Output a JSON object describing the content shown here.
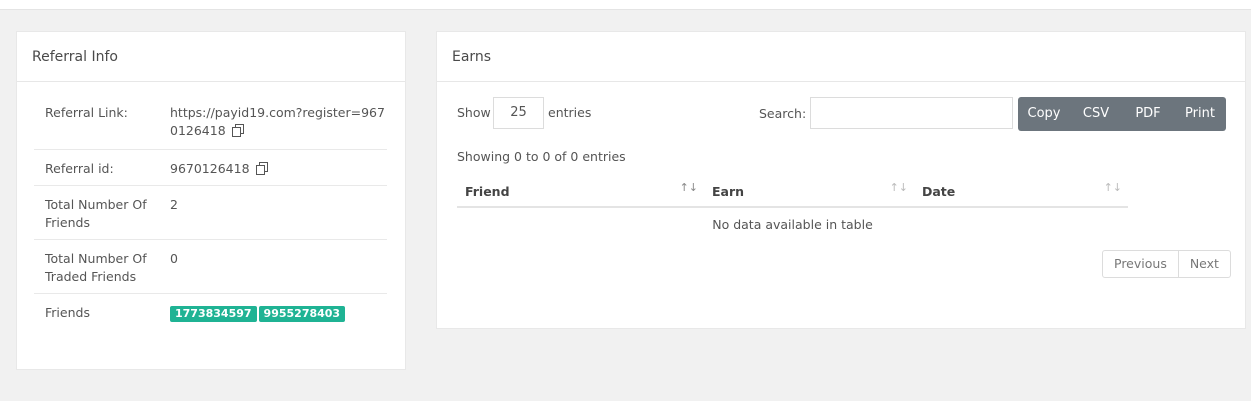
{
  "referral": {
    "title": "Referral Info",
    "rows": [
      {
        "label": "Referral Link:",
        "value": "https://payid19.com?register=9670126418"
      },
      {
        "label": "Referral id:",
        "value": "9670126418"
      },
      {
        "label": "Total Number Of Friends",
        "value": "2"
      },
      {
        "label": "Total Number Of Traded Friends",
        "value": "0"
      },
      {
        "label": "Friends",
        "badges": [
          "1773834597",
          "9955278403"
        ]
      }
    ]
  },
  "earns": {
    "title": "Earns",
    "show_label": "Show",
    "page_length": "25",
    "entries_label": "entries",
    "search_label": "Search:",
    "search_value": "",
    "buttons": [
      "Copy",
      "CSV",
      "PDF",
      "Print"
    ],
    "info": "Showing 0 to 0 of 0 entries",
    "columns": [
      "Friend",
      "Earn",
      "Date"
    ],
    "empty_message": "No data available in table",
    "pagination": {
      "previous": "Previous",
      "next": "Next"
    }
  }
}
